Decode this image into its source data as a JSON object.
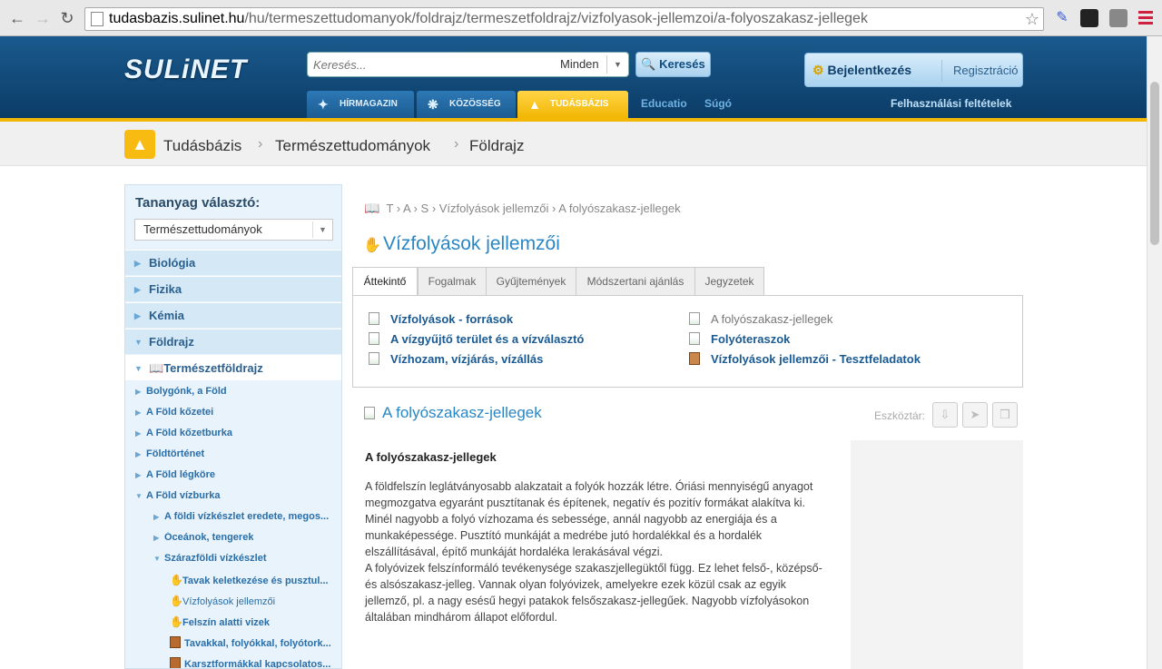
{
  "browser": {
    "url_host": "tudasbazis.sulinet.hu",
    "url_path": "/hu/termeszettudomanyok/foldrajz/termeszetfoldrajz/vizfolyasok-jellemzoi/a-folyoszakasz-jellegek"
  },
  "site": {
    "logo": "SULiNET",
    "search_placeholder": "Keresés...",
    "search_scope": "Minden",
    "search_button": "Keresés",
    "login_label": "Bejelentkezés",
    "register_label": "Regisztráció",
    "nav_tabs": [
      {
        "label": "HÍRMAGAZIN"
      },
      {
        "label": "KÖZÖSSÉG"
      },
      {
        "label": "TUDÁSBÁZIS"
      }
    ],
    "nav_links": [
      "Educatio",
      "Súgó"
    ],
    "terms_link": "Felhasználási feltételek"
  },
  "breadcrumb": [
    "Tudásbázis",
    "Természettudományok",
    "Földrajz"
  ],
  "sidebar": {
    "title": "Tananyag választó:",
    "selected": "Természettudományok",
    "categories": [
      "Biológia",
      "Fizika",
      "Kémia",
      "Földrajz"
    ],
    "subcategory": "Természetföldrajz",
    "items": [
      "Bolygónk, a Föld",
      "A Föld kőzetei",
      "A Föld kőzetburka",
      "Földtörténet",
      "A Föld légköre",
      "A Föld vízburka"
    ],
    "subitems": [
      "A földi vízkészlet eredete, megos...",
      "Óceánok, tengerek",
      "Szárazföldi vízkészlet"
    ],
    "leaves": [
      "Tavak keletkezése és pusztul...",
      "Vízfolyások jellemzői",
      "Felszín alatti vizek",
      "Tavakkal, folyókkal, folyótork...",
      "Karsztformákkal kapcsolatos..."
    ]
  },
  "main": {
    "crumbs": [
      "T",
      "A",
      "S",
      "Vízfolyások jellemzői",
      "A folyószakasz-jellegek"
    ],
    "title": "Vízfolyások jellemzői",
    "tabs": [
      "Áttekintő",
      "Fogalmak",
      "Gyűjtemények",
      "Módszertani ajánlás",
      "Jegyzetek"
    ],
    "links_left": [
      "Vízfolyások - források",
      "A vízgyűjtő terület és a vízválasztó",
      "Vízhozam, vízjárás, vízállás"
    ],
    "links_right": [
      "A folyószakasz-jellegek",
      "Folyóteraszok",
      "Vízfolyások jellemzői - Tesztfeladatok"
    ],
    "article_title": "A folyószakasz-jellegek",
    "tools_label": "Eszköztár:",
    "article_heading": "A folyószakasz-jellegek",
    "paragraphs": [
      "A földfelszín leglátványosabb alakzatait a folyók hozzák létre. Óriási mennyiségű anyagot megmozgatva egyaránt pusztítanak és építenek, negatív és pozitív formákat alakítva ki.",
      "Minél nagyobb a folyó vízhozama és sebessége, annál nagyobb az energiája és a munkaképessége. Pusztító munkáját a medrébe jutó hordalékkal és a hordalék elszállításával, építő munkáját hordaléka lerakásával végzi.",
      "A folyóvizek felszínformáló tevékenysége szakaszjellegüktől függ. Ez lehet felső-, középső- és alsószakasz-jelleg. Vannak olyan folyóvizek, amelyekre ezek közül csak az egyik jellemző, pl. a nagy esésű hegyi patakok felsőszakasz-jellegűek. Nagyobb vízfolyásokon általában mindhárom állapot előfordul."
    ]
  },
  "colors": {
    "accent": "#f2b705",
    "link": "#2a86c4",
    "header": "#0b3c66"
  }
}
